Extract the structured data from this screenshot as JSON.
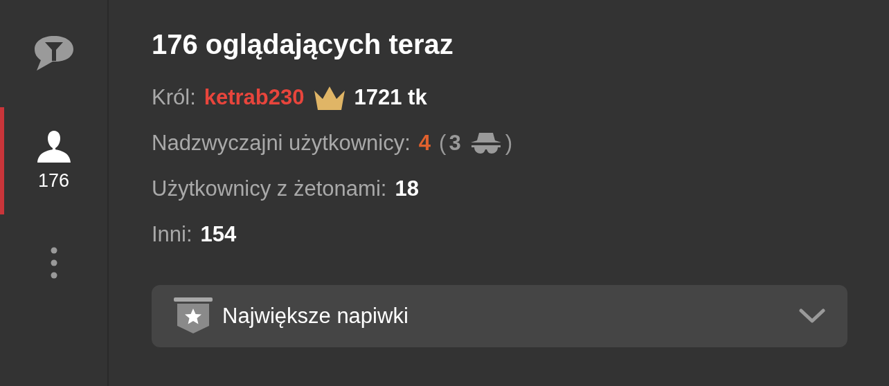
{
  "sidebar": {
    "tabs": [
      {
        "kind": "chat-filter",
        "selected": false
      },
      {
        "kind": "users",
        "selected": true,
        "count": "176"
      },
      {
        "kind": "more",
        "selected": false
      }
    ]
  },
  "title": "176 oglądających teraz",
  "stats": [
    {
      "label": "Król:",
      "kind": "king",
      "name": "ketrab230",
      "amount": "1721 tk"
    },
    {
      "label": "Nadzwyczajni użytkownicy:",
      "kind": "special",
      "value": "4",
      "open": "(",
      "hidden": "3",
      "close": ")"
    },
    {
      "label": "Użytkownicy z żetonami:",
      "kind": "plain",
      "value": "18"
    },
    {
      "label": "Inni:",
      "kind": "plain",
      "value": "154"
    }
  ],
  "dropdown": {
    "label": "Największe napiwki",
    "expanded": false
  }
}
